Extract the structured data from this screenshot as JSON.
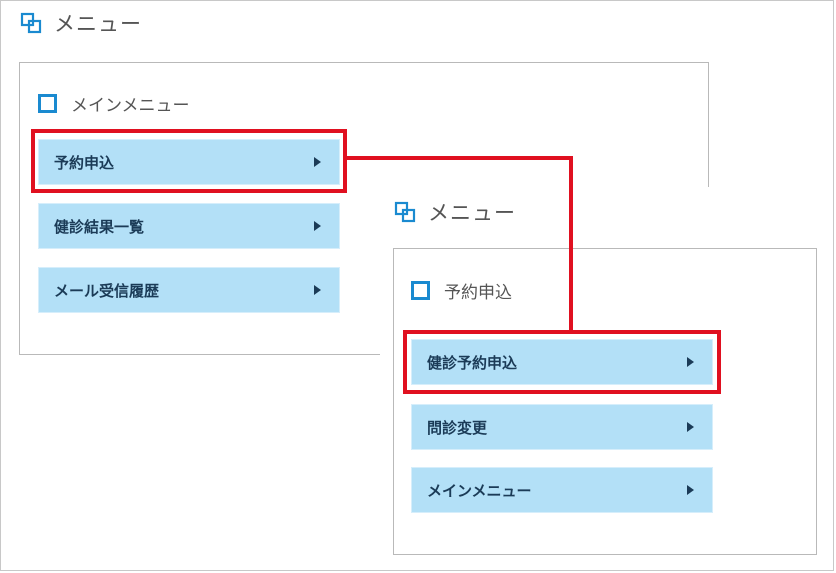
{
  "main": {
    "header": {
      "title": "メニュー"
    },
    "section": {
      "title": "メインメニュー"
    },
    "items": [
      {
        "label": "予約申込"
      },
      {
        "label": "健診結果一覧"
      },
      {
        "label": "メール受信履歴"
      }
    ]
  },
  "sub": {
    "header": {
      "title": "メニュー"
    },
    "section": {
      "title": "予約申込"
    },
    "items": [
      {
        "label": "健診予約申込"
      },
      {
        "label": "問診変更"
      },
      {
        "label": "メインメニュー"
      }
    ]
  },
  "colors": {
    "accent_blue": "#1a8ad0",
    "button_bg": "#b3e0f7",
    "button_text": "#1b3b57",
    "highlight_red": "#e01020"
  }
}
